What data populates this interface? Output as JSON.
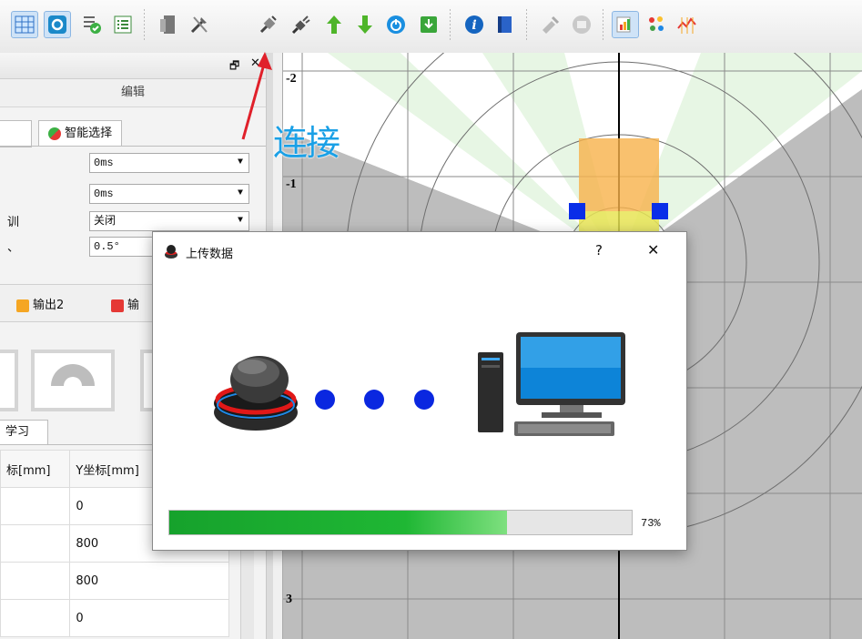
{
  "left_panel": {
    "header_tab": "编辑",
    "smart_select_label": "智能选择",
    "rows": [
      {
        "label": "",
        "value": "0ms"
      },
      {
        "label": "",
        "value": "0ms"
      },
      {
        "label": "训",
        "value": "关闭"
      },
      {
        "label": "、",
        "value": "0.5°"
      }
    ],
    "outputs": [
      {
        "label": "输出2",
        "color": "#f5a623"
      },
      {
        "label": "输",
        "color": "#e53935"
      }
    ],
    "learn_tab": "学习",
    "table": {
      "headers": [
        "标[mm]",
        "Y坐标[mm]"
      ],
      "rows": [
        [
          "",
          "0"
        ],
        [
          "",
          "800"
        ],
        [
          "",
          "800"
        ],
        [
          "",
          "0"
        ]
      ]
    }
  },
  "annotation": {
    "label": "连接",
    "color": "#1aa0e6"
  },
  "canvas": {
    "axis_labels": [
      "-2",
      "-1",
      "3"
    ]
  },
  "dialog": {
    "title": "上传数据",
    "help": "?",
    "close": "✕",
    "progress_percent": 73,
    "progress_text": "73%"
  },
  "icons": [
    "table-icon",
    "settings-icon",
    "check-doc-icon",
    "list-icon",
    "server-icon",
    "tools-icon",
    "plug-icon",
    "plug-connect-icon",
    "upload-icon",
    "download-icon",
    "power-icon",
    "save-icon",
    "info-icon",
    "book-icon",
    "disabled-tool-icon",
    "disabled-disk-icon",
    "chart-icon",
    "palette-icon",
    "line-chart-icon"
  ]
}
